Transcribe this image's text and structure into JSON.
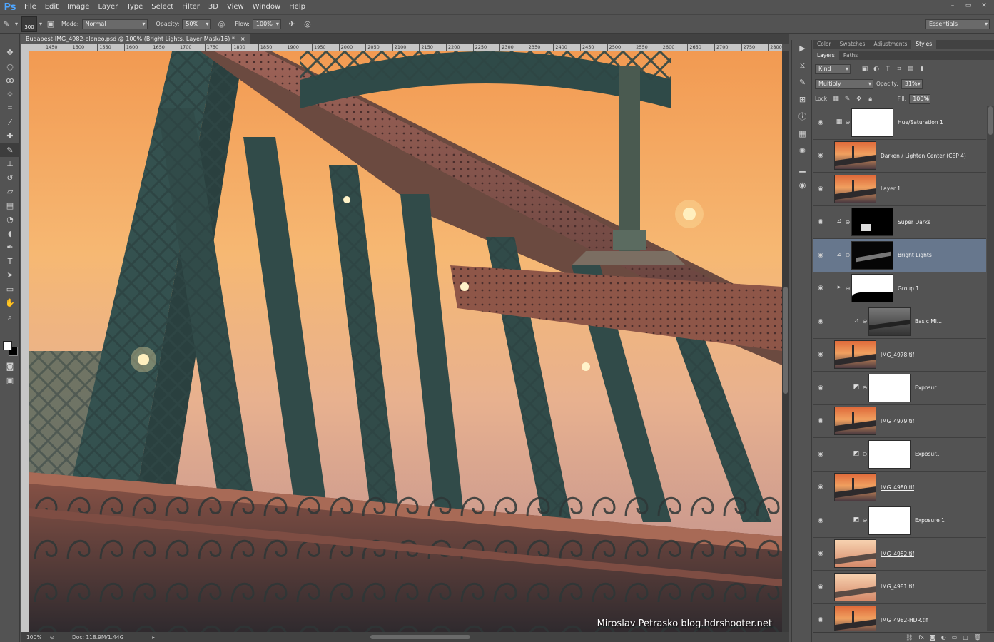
{
  "app": {
    "logo": "Ps",
    "menu": [
      "File",
      "Edit",
      "Image",
      "Layer",
      "Type",
      "Select",
      "Filter",
      "3D",
      "View",
      "Window",
      "Help"
    ],
    "window_controls": [
      "–",
      "▭",
      "✕"
    ]
  },
  "options_bar": {
    "brush_size": "300",
    "mode_label": "Mode:",
    "mode_value": "Normal",
    "opacity_label": "Opacity:",
    "opacity_value": "50%",
    "flow_label": "Flow:",
    "flow_value": "100%",
    "workspace": "Essentials"
  },
  "document": {
    "tab_title": "Budapest-IMG_4982-oloneo.psd @ 100% (Bright Lights, Layer Mask/16) *",
    "tab_close": "×",
    "ruler_ticks": [
      "1450",
      "1500",
      "1550",
      "1600",
      "1650",
      "1700",
      "1750",
      "1800",
      "1850",
      "1900",
      "1950",
      "2000",
      "2050",
      "2100",
      "2150",
      "2200",
      "2250",
      "2300",
      "2350",
      "2400",
      "2450",
      "2500",
      "2550",
      "2600",
      "2650",
      "2700",
      "2750",
      "2800"
    ],
    "watermark": "Miroslav Petrasko blog.hdrshooter.net"
  },
  "status": {
    "zoom": "100%",
    "doc_info": "Doc: 118.9M/1.44G"
  },
  "panels": {
    "top_tabs": [
      "Color",
      "Swatches",
      "Adjustments",
      "Styles"
    ],
    "layer_tabs": [
      "Layers",
      "Paths"
    ],
    "filter_kind": "Kind",
    "blend_mode": "Multiply",
    "opacity_label": "Opacity:",
    "opacity_value": "31%",
    "lock_label": "Lock:",
    "fill_label": "Fill:",
    "fill_value": "100%"
  },
  "layers": [
    {
      "name": "Hue/Saturation 1",
      "thumb": "white",
      "adj": "▦",
      "selected": false,
      "underline": false,
      "indent": 0
    },
    {
      "name": "Darken / Lighten Center (CEP 4)",
      "thumb": "photo",
      "adj": "",
      "selected": false,
      "underline": false,
      "indent": 0
    },
    {
      "name": "Layer 1",
      "thumb": "photo",
      "adj": "",
      "selected": false,
      "underline": false,
      "indent": 0
    },
    {
      "name": "Super Darks",
      "thumb": "dark-mask",
      "adj": "⊿",
      "selected": false,
      "underline": false,
      "indent": 0
    },
    {
      "name": "Bright Lights",
      "thumb": "bridge-mask",
      "adj": "⊿",
      "selected": true,
      "underline": false,
      "indent": 0
    },
    {
      "name": "Group 1",
      "thumb": "group-mask",
      "adj": "▸",
      "selected": false,
      "underline": false,
      "indent": 0
    },
    {
      "name": "Basic Mi...",
      "thumb": "gray-photo",
      "adj": "⊿",
      "selected": false,
      "underline": false,
      "indent": 1
    },
    {
      "name": "IMG_4978.tif",
      "thumb": "photo",
      "adj": "",
      "selected": false,
      "underline": false,
      "indent": 0
    },
    {
      "name": "Exposur...",
      "thumb": "white",
      "adj": "◩",
      "selected": false,
      "underline": false,
      "indent": 1
    },
    {
      "name": "IMG_4979.tif",
      "thumb": "photo",
      "adj": "",
      "selected": false,
      "underline": true,
      "indent": 0
    },
    {
      "name": "Exposur...",
      "thumb": "white",
      "adj": "◩",
      "selected": false,
      "underline": false,
      "indent": 1
    },
    {
      "name": "IMG_4980.tif",
      "thumb": "photo",
      "adj": "",
      "selected": false,
      "underline": true,
      "indent": 0
    },
    {
      "name": "Exposure 1",
      "thumb": "white",
      "adj": "◩",
      "selected": false,
      "underline": false,
      "indent": 1
    },
    {
      "name": "IMG_4982.tif",
      "thumb": "photo-bright",
      "adj": "",
      "selected": false,
      "underline": true,
      "indent": 0
    },
    {
      "name": "IMG_4981.tif",
      "thumb": "photo-bright",
      "adj": "",
      "selected": false,
      "underline": false,
      "indent": 0
    },
    {
      "name": "IMG_4982-HDR.tif",
      "thumb": "photo",
      "adj": "",
      "selected": false,
      "underline": false,
      "indent": 0
    }
  ],
  "colors": {
    "accent": "#4fa6ff",
    "selected_row": "#67778d",
    "sky_top": "#f4a15a",
    "sky_bottom": "#f7c98a",
    "steel": "#3d5a58",
    "copper": "#9c5b4a"
  }
}
